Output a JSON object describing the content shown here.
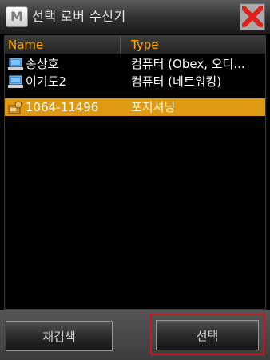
{
  "window": {
    "icon_letter": "M",
    "title": "선택 로버 수신기",
    "close_icon": "close-icon"
  },
  "list": {
    "headers": {
      "name": "Name",
      "type": "Type"
    },
    "rows": [
      {
        "icon": "computer-icon",
        "name": "송상호",
        "type": "컴퓨터 (Obex, 오디...",
        "selected": false
      },
      {
        "icon": "computer-icon",
        "name": "이기도2",
        "type": "컴퓨터 (네트워킹)",
        "selected": false
      },
      {
        "icon": "gps-receiver-icon",
        "name": "1064-11496",
        "type": "포지셔닝",
        "selected": true
      }
    ]
  },
  "buttons": {
    "rescan": "재검색",
    "select": "선택"
  },
  "colors": {
    "header_text": "#ffa800",
    "selected_row": "#de9a12",
    "highlight_border": "#d0141c"
  }
}
